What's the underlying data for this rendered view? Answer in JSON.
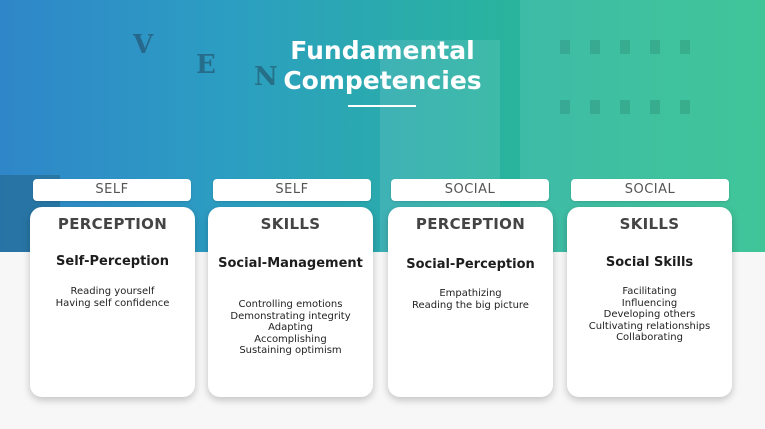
{
  "title": {
    "line1": "Fundamental",
    "line2": "Competencies"
  },
  "hero": {
    "sign_letters": [
      "V",
      "E",
      "N"
    ]
  },
  "colors": {
    "gradient_left": "#2f86c9",
    "gradient_right": "#2bbf8d",
    "text_dark": "#444444"
  },
  "columns": [
    {
      "tab": "SELF",
      "heading": "PERCEPTION",
      "subheading": "Self-Perception",
      "items": [
        "Reading yourself",
        "Having self confidence"
      ]
    },
    {
      "tab": "SELF",
      "heading": "SKILLS",
      "subheading": "Social-Management",
      "items": [
        "Controlling emotions",
        "Demonstrating integrity",
        "Adapting",
        "Accomplishing",
        "Sustaining optimism"
      ]
    },
    {
      "tab": "SOCIAL",
      "heading": "PERCEPTION",
      "subheading": "Social-Perception",
      "items": [
        "Empathizing",
        "Reading the big picture"
      ]
    },
    {
      "tab": "SOCIAL",
      "heading": "SKILLS",
      "subheading": "Social Skills",
      "items": [
        "Facilitating",
        "Influencing",
        "Developing others",
        "Cultivating relationships",
        "Collaborating"
      ]
    }
  ]
}
